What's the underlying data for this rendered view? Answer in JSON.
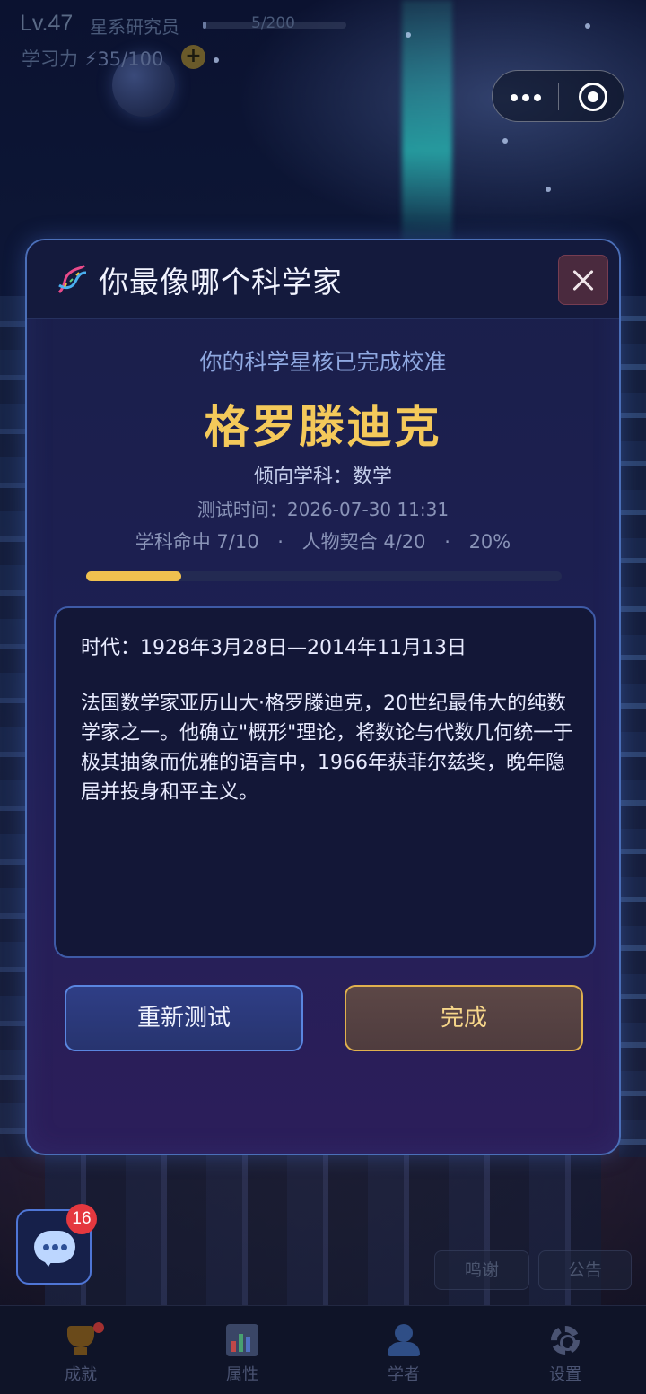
{
  "status": {
    "level": "Lv.47",
    "rank_title": "星系研究员",
    "xp_text": "5/200",
    "xp_progress": 0.025,
    "power_label": "学习力",
    "power_value": "⚡35/100",
    "plus_label": "+"
  },
  "capsule": {
    "more_icon": "more-dots-icon",
    "target_icon": "target-icon"
  },
  "modal": {
    "title": "你最像哪个科学家",
    "title_icon": "dna-icon",
    "close_icon": "close-icon",
    "subtitle": "你的科学星核已完成校准",
    "scientist_name": "格罗滕迪克",
    "discipline": "倾向学科：数学",
    "test_time": "测试时间：2026-07-30 11:31",
    "stat_subject_hit": "学科命中 7/10",
    "stat_dot": "·",
    "stat_character_match": "人物契合 4/20",
    "stat_percent": "20%",
    "match_progress": 0.2,
    "era": "时代：1928年3月28日—2014年11月13日",
    "bio": "法国数学家亚历山大·格罗滕迪克，20世纪最伟大的纯数学家之一。他确立\"概形\"理论，将数论与代数几何统一于极其抽象而优雅的语言中，1966年获菲尔兹奖，晚年隐居并投身和平主义。",
    "retest_label": "重新测试",
    "done_label": "完成"
  },
  "floating": {
    "chat_icon": "chat-bubble-icon",
    "chat_badge": "16",
    "thanks_label": "鸣谢",
    "notice_label": "公告"
  },
  "tabbar": {
    "tabs": [
      {
        "label": "成就",
        "icon": "trophy-icon"
      },
      {
        "label": "属性",
        "icon": "bar-chart-icon"
      },
      {
        "label": "学者",
        "icon": "person-icon"
      },
      {
        "label": "设置",
        "icon": "gear-icon"
      }
    ]
  },
  "colors": {
    "accent_gold": "#f4c95a",
    "accent_blue": "#5a86e0",
    "badge_red": "#e5383f"
  }
}
